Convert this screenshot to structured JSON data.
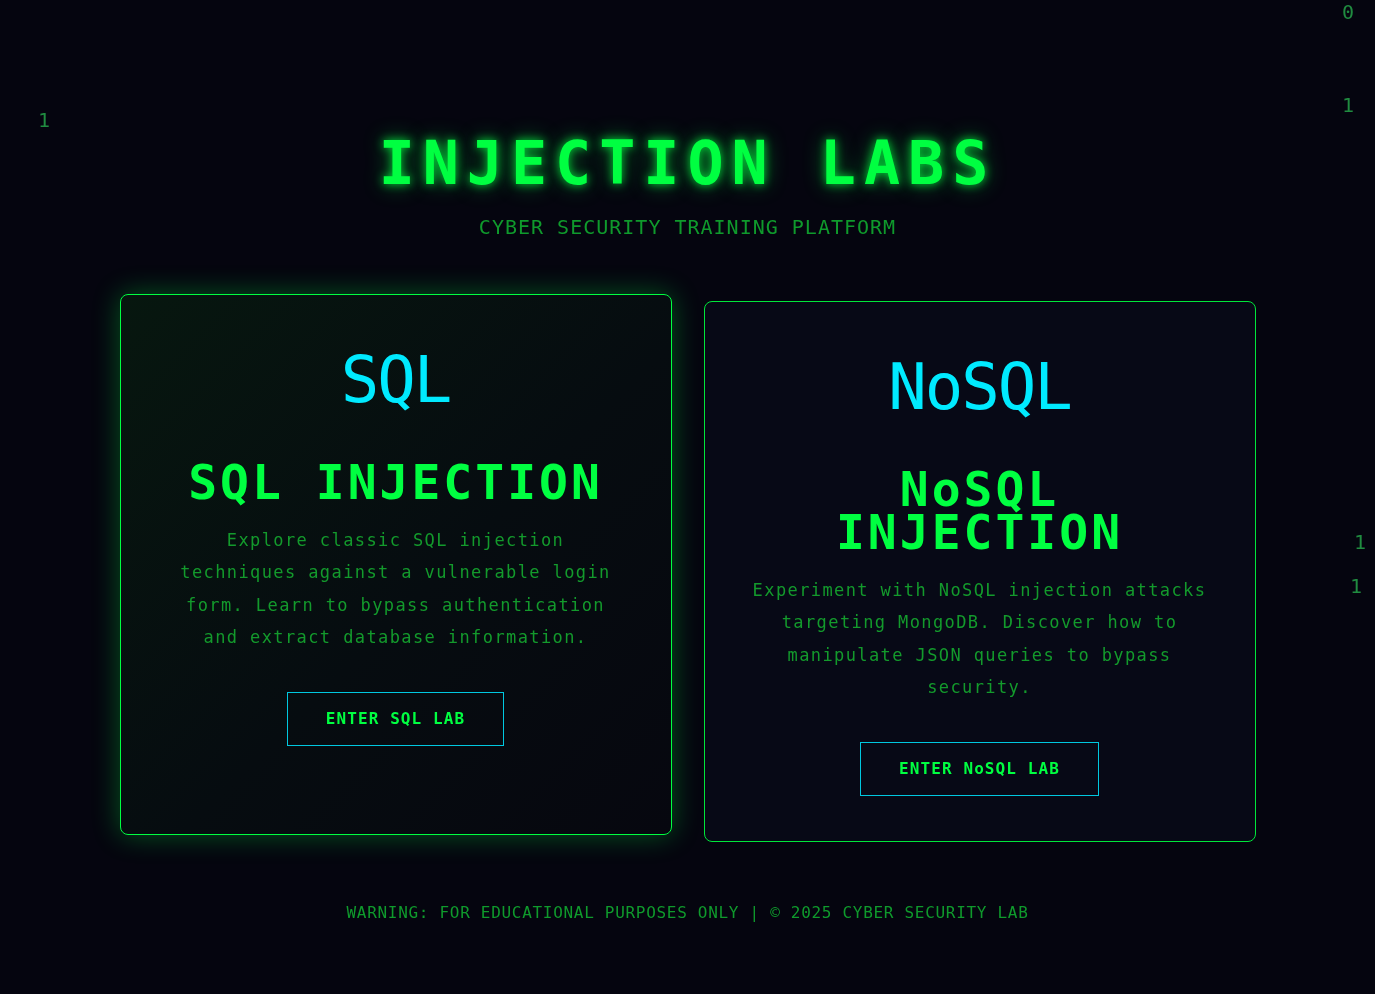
{
  "background_digits": [
    "0",
    "1",
    "1",
    "1",
    "1"
  ],
  "header": {
    "title": "INJECTION LABS",
    "subtitle": "CYBER SECURITY TRAINING PLATFORM"
  },
  "cards": [
    {
      "logo": "SQL",
      "title": "SQL INJECTION",
      "description": "Explore classic SQL injection techniques against a vulnerable login form. Learn to bypass authentication and extract database information.",
      "button": "ENTER SQL LAB",
      "hovered": true
    },
    {
      "logo": "NoSQL",
      "title": "NoSQL INJECTION",
      "description": "Experiment with NoSQL injection attacks targeting MongoDB. Discover how to manipulate JSON queries to bypass security.",
      "button": "ENTER NoSQL LAB",
      "hovered": false
    }
  ],
  "footer": "WARNING: FOR EDUCATIONAL PURPOSES ONLY | © 2025 CYBER SECURITY LAB"
}
